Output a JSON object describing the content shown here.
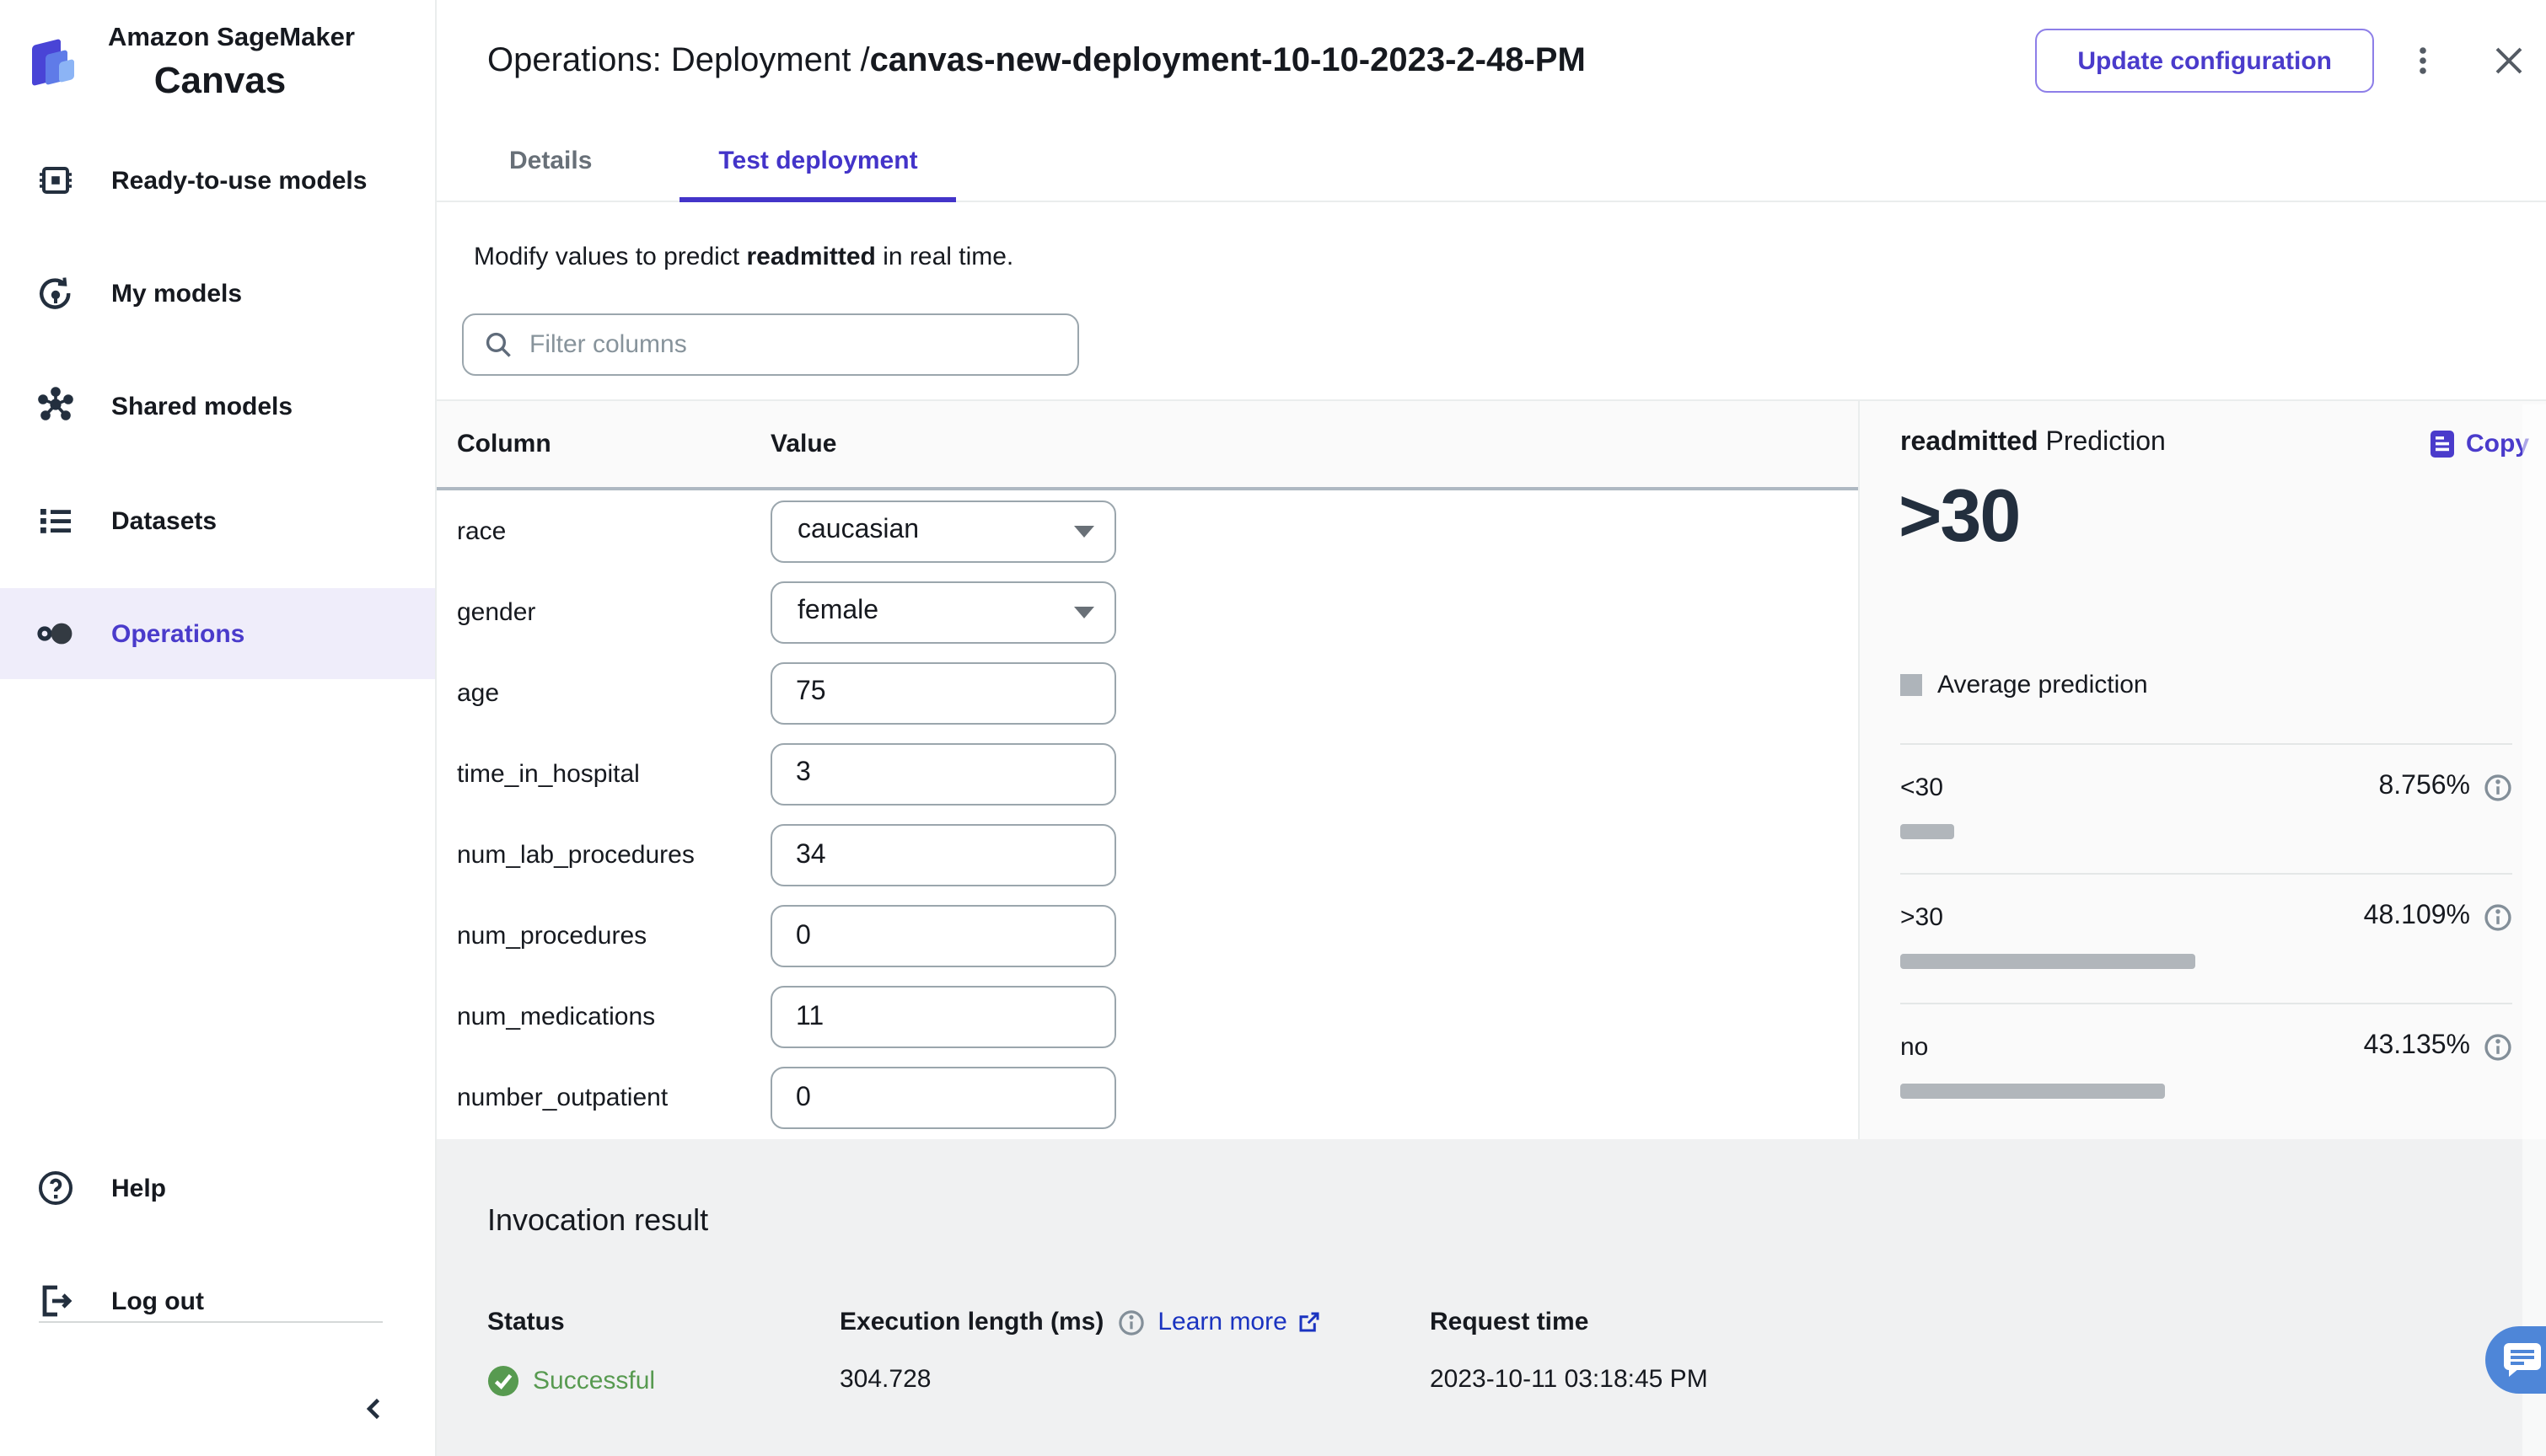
{
  "app": {
    "brand_line1": "Amazon SageMaker",
    "brand_line2": "Canvas"
  },
  "sidebar": {
    "items": [
      {
        "label": "Ready-to-use models"
      },
      {
        "label": "My models"
      },
      {
        "label": "Shared models"
      },
      {
        "label": "Datasets"
      },
      {
        "label": "Operations"
      }
    ],
    "help_label": "Help",
    "logout_label": "Log out"
  },
  "header": {
    "title_prefix": "Operations: Deployment / ",
    "title_name": "canvas-new-deployment-10-10-2023-2-48-PM",
    "update_button": "Update configuration"
  },
  "tabs": [
    {
      "label": "Details"
    },
    {
      "label": "Test deployment"
    }
  ],
  "test_panel": {
    "intro_prefix": "Modify values to predict ",
    "intro_target": "readmitted",
    "intro_suffix": " in real time.",
    "filter_placeholder": "Filter columns"
  },
  "table": {
    "col_header": "Column",
    "val_header": "Value",
    "rows": [
      {
        "name": "race",
        "value": "caucasian"
      },
      {
        "name": "gender",
        "value": "female"
      },
      {
        "name": "age",
        "value": "75"
      },
      {
        "name": "time_in_hospital",
        "value": "3"
      },
      {
        "name": "num_lab_procedures",
        "value": "34"
      },
      {
        "name": "num_procedures",
        "value": "0"
      },
      {
        "name": "num_medications",
        "value": "11"
      },
      {
        "name": "number_outpatient",
        "value": "0"
      }
    ]
  },
  "prediction": {
    "target": "readmitted",
    "heading_suffix": " Prediction",
    "copy_label": "Copy",
    "value": ">30",
    "legend": "Average prediction",
    "rows": [
      {
        "label": "<30",
        "pct_label": "8.756%",
        "pct": 8.756
      },
      {
        "label": ">30",
        "pct_label": "48.109%",
        "pct": 48.109
      },
      {
        "label": "no",
        "pct_label": "43.135%",
        "pct": 43.135
      }
    ]
  },
  "invocation": {
    "heading": "Invocation result",
    "status_header": "Status",
    "exec_header": "Execution length (ms)",
    "learn_more": "Learn more",
    "request_header": "Request time",
    "status_value": "Successful",
    "exec_value": "304.728",
    "request_value": "2023-10-11 03:18:45 PM"
  },
  "colors": {
    "accent_purple": "#4a3bcb",
    "tab_purple": "#4334c9",
    "link_blue": "#1a33c0",
    "success_green": "#579a50",
    "chat_blue": "#4e86d8",
    "bar_gray": "#b1b6bb",
    "active_nav_bg": "#efedfa"
  }
}
